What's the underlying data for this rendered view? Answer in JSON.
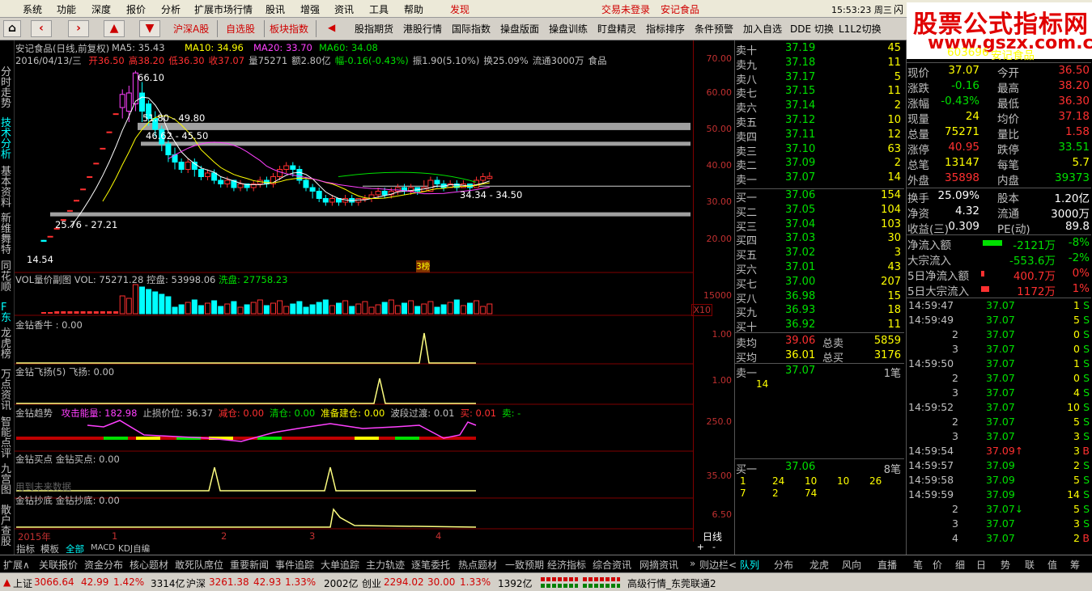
{
  "menu": [
    "系统",
    "功能",
    "深度",
    "报价",
    "分析",
    "扩展市场行情",
    "股讯",
    "增强",
    "资讯",
    "工具",
    "帮助",
    "发现"
  ],
  "login_status": "交易未登录",
  "login_stock": "安记食品",
  "clock": "15:53:23 周三",
  "clock_btn": "闪",
  "toolbar": [
    "沪深A股",
    "自选股",
    "板块指数",
    "股指期货",
    "港股行情",
    "国际指数",
    "操盘版面",
    "操盘训练",
    "盯盘精灵",
    "指标排序",
    "条件预警",
    "加入自选",
    "DDE 切换",
    "L1L2切换"
  ],
  "brand": {
    "title": "股票公式指标网",
    "url": "www.gszx.com.cn"
  },
  "left_nav": [
    "分时走势",
    "技术分析",
    "基本资料",
    "新维舞特",
    "同花顺",
    "F东",
    "龙虎榜",
    "万点资讯",
    "智能点评",
    "九宫图",
    "散户查股"
  ],
  "chart": {
    "title": "安记食品(日线,前复权)",
    "ma": [
      {
        "label": "MA5: 35.43",
        "color": "#ffffff"
      },
      {
        "label": "MA10: 34.96",
        "color": "#ffff00"
      },
      {
        "label": "MA20: 33.70",
        "color": "#ff40ff"
      },
      {
        "label": "MA60: 34.08",
        "color": "#00e000"
      }
    ],
    "info_date": "2016/04/13/三",
    "info_items": [
      {
        "t": "开36.50",
        "c": "#ff3030"
      },
      {
        "t": "高38.20",
        "c": "#ff3030"
      },
      {
        "t": "低36.30",
        "c": "#ff3030"
      },
      {
        "t": "收37.07",
        "c": "#ff3030"
      },
      {
        "t": "量75271",
        "c": "#c0c0c0"
      },
      {
        "t": "额2.80亿",
        "c": "#c0c0c0"
      },
      {
        "t": "幅-0.16(-0.43%)",
        "c": "#00e000"
      },
      {
        "t": "振1.90(5.10%)",
        "c": "#c0c0c0"
      },
      {
        "t": "换25.09%",
        "c": "#c0c0c0"
      },
      {
        "t": "流通3000万",
        "c": "#c0c0c0"
      },
      {
        "t": "食品",
        "c": "#c0c0c0"
      }
    ],
    "annotations": {
      "high": "66.10",
      "r1": "51.80 - 49.80",
      "r2": "46.62 - 45.50",
      "r3": "34.34 - 34.50",
      "r4": "25.76 - 27.21",
      "low": "14.54",
      "tag": "3榜"
    },
    "price_scale": [
      "70.00",
      "60.00",
      "50.00",
      "40.00",
      "30.00",
      "20.00"
    ],
    "vol_title": "VOL量价副图",
    "vol": "VOL: 75271.28",
    "kong": "控盘: 53998.06",
    "xi": "洗盘: 27758.23",
    "vol_scale": "15000",
    "vol_x": "X10",
    "ind1_title": "金钻香牛 : 0.00",
    "ind1_scale": "1.00",
    "ind2_title": "金钻飞扬(5)",
    "ind2_val": "飞扬: 0.00",
    "ind2_scale": "1.00",
    "ind3_title": "金钻趋势",
    "ind3_items": [
      {
        "t": "攻击能量: 182.98",
        "c": "#ff40ff"
      },
      {
        "t": "止损价位: 36.37",
        "c": "#c0c0c0"
      },
      {
        "t": "减仓: 0.00",
        "c": "#ff3030"
      },
      {
        "t": "清仓: 0.00",
        "c": "#00e000"
      },
      {
        "t": "准备建仓: 0.00",
        "c": "#ffff00"
      },
      {
        "t": "波段过渡: 0.01",
        "c": "#c0c0c0"
      },
      {
        "t": "买: 0.01",
        "c": "#ff3030"
      },
      {
        "t": "卖: -",
        "c": "#00e000"
      }
    ],
    "ind3_scale": "250.0",
    "ind4_title": "金钻买点",
    "ind4_val": "金钻买点: 0.00",
    "ind4_scale": "35.00",
    "future": "用到未来数据",
    "ind5_title": "金钻抄底",
    "ind5_val": "金钻抄底: 0.00",
    "ind5_scale": "6.50",
    "x_labels": [
      "2015年",
      "1",
      "2",
      "3",
      "4"
    ],
    "period": "日线",
    "tabs": [
      "指标",
      "模板",
      "全部",
      "MACD",
      "KDJ自编"
    ]
  },
  "orderbook": {
    "asks": [
      [
        "卖十",
        "37.19",
        "45"
      ],
      [
        "卖九",
        "37.18",
        "11"
      ],
      [
        "卖八",
        "37.17",
        "5"
      ],
      [
        "卖七",
        "37.15",
        "11"
      ],
      [
        "卖六",
        "37.14",
        "2"
      ],
      [
        "卖五",
        "37.12",
        "10"
      ],
      [
        "卖四",
        "37.11",
        "12"
      ],
      [
        "卖三",
        "37.10",
        "63"
      ],
      [
        "卖二",
        "37.09",
        "2"
      ],
      [
        "卖一",
        "37.07",
        "14"
      ]
    ],
    "bids": [
      [
        "买一",
        "37.06",
        "154"
      ],
      [
        "买二",
        "37.05",
        "104"
      ],
      [
        "买三",
        "37.04",
        "103"
      ],
      [
        "买四",
        "37.03",
        "30"
      ],
      [
        "买五",
        "37.02",
        "3"
      ],
      [
        "买六",
        "37.01",
        "43"
      ],
      [
        "买七",
        "37.00",
        "207"
      ],
      [
        "买八",
        "36.98",
        "15"
      ],
      [
        "买九",
        "36.93",
        "18"
      ],
      [
        "买十",
        "36.92",
        "11"
      ]
    ],
    "sell_avg": [
      "卖均",
      "39.06",
      "总卖",
      "5859"
    ],
    "buy_avg": [
      "买均",
      "36.01",
      "总买",
      "3176"
    ],
    "queue_sell": {
      "label": "卖一",
      "price": "37.07",
      "count": "1笔",
      "vols": [
        "14"
      ]
    },
    "queue_buy": {
      "label": "买一",
      "price": "37.06",
      "count": "8笔",
      "vols": [
        "1",
        "24",
        "10",
        "10",
        "26",
        "7",
        "2",
        "74"
      ]
    }
  },
  "quote": {
    "code": "603696",
    "name": "安记食品",
    "rows": [
      [
        "现价",
        "37.07",
        "今开",
        "36.50"
      ],
      [
        "涨跌",
        "-0.16",
        "最高",
        "38.20"
      ],
      [
        "涨幅",
        "-0.43%",
        "最低",
        "36.30"
      ],
      [
        "现量",
        "24",
        "均价",
        "37.18"
      ],
      [
        "总量",
        "75271",
        "量比",
        "1.58"
      ],
      [
        "涨停",
        "40.95",
        "跌停",
        "33.51"
      ],
      [
        "总笔",
        "13147",
        "每笔",
        "5.7"
      ],
      [
        "外盘",
        "35898",
        "内盘",
        "39373"
      ]
    ],
    "rows2": [
      [
        "换手",
        "25.09%",
        "股本",
        "1.20亿"
      ],
      [
        "净资",
        "4.32",
        "流通",
        "3000万"
      ],
      [
        "收益(三)",
        "0.309",
        "PE(动)",
        "89.8"
      ]
    ],
    "flow": [
      [
        "净流入额",
        "-2121万",
        "-8%"
      ],
      [
        "大宗流入",
        "-553.6万",
        "-2%"
      ],
      [
        "5日净流入额",
        "400.7万",
        "0%"
      ],
      [
        "5日大宗流入",
        "1172万",
        "1%"
      ]
    ],
    "ticks": [
      [
        "14:59:47",
        "37.07",
        "1",
        "S"
      ],
      [
        "14:59:49",
        "37.07",
        "5",
        "S"
      ],
      [
        "2",
        "37.07",
        "0",
        "S"
      ],
      [
        "3",
        "37.07",
        "0",
        "S"
      ],
      [
        "14:59:50",
        "37.07",
        "1",
        "S"
      ],
      [
        "2",
        "37.07",
        "0",
        "S"
      ],
      [
        "3",
        "37.07",
        "4",
        "S"
      ],
      [
        "14:59:52",
        "37.07",
        "10",
        "S"
      ],
      [
        "2",
        "37.07",
        "5",
        "S"
      ],
      [
        "3",
        "37.07",
        "3",
        "S"
      ],
      [
        "14:59:54",
        "37.09↑",
        "3",
        "B"
      ],
      [
        "14:59:57",
        "37.09",
        "2",
        "S"
      ],
      [
        "14:59:58",
        "37.09",
        "5",
        "S"
      ],
      [
        "14:59:59",
        "37.09",
        "14",
        "S"
      ],
      [
        "2",
        "37.07↓",
        "5",
        "S"
      ],
      [
        "3",
        "37.07",
        "3",
        "S"
      ],
      [
        "4",
        "37.07",
        "2",
        "B"
      ]
    ]
  },
  "bottom_tabs": [
    "扩展∧",
    "关联报价",
    "资金分布",
    "核心题材",
    "敢死队席位",
    "重要新闻",
    "事件追踪",
    "大单追踪",
    "主力轨迹",
    "逐笔委托",
    "热点题材",
    "一致预期",
    "经济指标",
    "综合资讯",
    "网摘资讯",
    "»",
    "则边栏<",
    "队列",
    "分布",
    "龙虎",
    "风向",
    "直播",
    "笔",
    "价",
    "细",
    "日",
    "势",
    "联",
    "值",
    "筹"
  ],
  "status": {
    "sh_label": "上证",
    "sh_val": "3066.64",
    "sh_chg": "42.99",
    "sh_pct": "1.42%",
    "sh_amt": "3314亿",
    "sz_label": "沪深",
    "sz_val": "3261.38",
    "sz_chg": "42.93",
    "sz_pct": "1.33%",
    "sz_amt": "2002亿",
    "cy_label": "创业",
    "cy_val": "2294.02",
    "cy_chg": "30.00",
    "cy_pct": "1.33%",
    "cy_amt": "1392亿",
    "feed": "高级行情_东莞联通2"
  },
  "candles": [
    {
      "o": 19.5,
      "c": 19.2,
      "h": 19.6,
      "l": 19.1
    },
    {
      "o": 20.5,
      "c": 20.6,
      "h": 20.7,
      "l": 20.4
    },
    {
      "o": 22.7,
      "c": 22.8,
      "h": 22.9,
      "l": 22.6
    },
    {
      "o": 25.1,
      "c": 25.2,
      "h": 25.3,
      "l": 25.0
    },
    {
      "o": 27.6,
      "c": 27.7,
      "h": 27.8,
      "l": 27.5
    },
    {
      "o": 30.4,
      "c": 30.5,
      "h": 30.6,
      "l": 30.3
    },
    {
      "o": 33.5,
      "c": 33.6,
      "h": 33.7,
      "l": 33.4
    },
    {
      "o": 36.9,
      "c": 37.0,
      "h": 37.1,
      "l": 36.8
    },
    {
      "o": 40.6,
      "c": 40.7,
      "h": 40.8,
      "l": 40.5
    },
    {
      "o": 44.7,
      "c": 44.8,
      "h": 44.9,
      "l": 44.6
    },
    {
      "o": 49.2,
      "c": 49.3,
      "h": 49.4,
      "l": 49.1
    },
    {
      "o": 54.2,
      "c": 54.3,
      "h": 54.4,
      "l": 54.1
    },
    {
      "o": 56,
      "c": 59.6,
      "h": 61,
      "l": 53
    },
    {
      "o": 55,
      "c": 60,
      "h": 62,
      "l": 52
    },
    {
      "o": 57,
      "c": 65.5,
      "h": 66.1,
      "l": 55
    },
    {
      "o": 60,
      "c": 55,
      "h": 63,
      "l": 52
    },
    {
      "o": 57,
      "c": 53,
      "h": 58,
      "l": 51
    },
    {
      "o": 53,
      "c": 50,
      "h": 55,
      "l": 48
    },
    {
      "o": 50,
      "c": 46,
      "h": 51,
      "l": 44
    },
    {
      "o": 46,
      "c": 43,
      "h": 47,
      "l": 41
    },
    {
      "o": 43,
      "c": 41,
      "h": 45,
      "l": 39
    },
    {
      "o": 41,
      "c": 39,
      "h": 42,
      "l": 38
    },
    {
      "o": 39,
      "c": 41,
      "h": 42,
      "l": 38
    },
    {
      "o": 41,
      "c": 39,
      "h": 42,
      "l": 37
    },
    {
      "o": 39,
      "c": 37,
      "h": 40,
      "l": 36
    },
    {
      "o": 37,
      "c": 38,
      "h": 39,
      "l": 36
    },
    {
      "o": 38,
      "c": 36,
      "h": 39,
      "l": 35
    },
    {
      "o": 36,
      "c": 35,
      "h": 37,
      "l": 34
    },
    {
      "o": 35,
      "c": 36,
      "h": 37,
      "l": 34
    },
    {
      "o": 36,
      "c": 34,
      "h": 36,
      "l": 33
    },
    {
      "o": 34,
      "c": 35,
      "h": 36,
      "l": 33
    },
    {
      "o": 35,
      "c": 34,
      "h": 35,
      "l": 33
    },
    {
      "o": 34,
      "c": 35,
      "h": 36,
      "l": 33
    },
    {
      "o": 35,
      "c": 36,
      "h": 37,
      "l": 34
    },
    {
      "o": 36,
      "c": 35,
      "h": 37,
      "l": 34
    },
    {
      "o": 35,
      "c": 37,
      "h": 38,
      "l": 34
    },
    {
      "o": 37,
      "c": 39,
      "h": 40,
      "l": 36
    },
    {
      "o": 39,
      "c": 40,
      "h": 41,
      "l": 38
    },
    {
      "o": 40,
      "c": 39,
      "h": 41,
      "l": 37
    },
    {
      "o": 39,
      "c": 36,
      "h": 40,
      "l": 35
    },
    {
      "o": 36,
      "c": 34,
      "h": 37,
      "l": 33
    },
    {
      "o": 34,
      "c": 33,
      "h": 35,
      "l": 31
    },
    {
      "o": 33,
      "c": 31,
      "h": 34,
      "l": 30
    },
    {
      "o": 31,
      "c": 30,
      "h": 32,
      "l": 29
    },
    {
      "o": 30,
      "c": 31,
      "h": 32,
      "l": 29
    },
    {
      "o": 31,
      "c": 30,
      "h": 31,
      "l": 29
    },
    {
      "o": 30,
      "c": 31,
      "h": 32,
      "l": 29
    },
    {
      "o": 31,
      "c": 30,
      "h": 32,
      "l": 29
    },
    {
      "o": 30,
      "c": 31,
      "h": 31,
      "l": 29
    },
    {
      "o": 31,
      "c": 31,
      "h": 32,
      "l": 30
    },
    {
      "o": 31,
      "c": 32,
      "h": 33,
      "l": 30
    },
    {
      "o": 32,
      "c": 33,
      "h": 34,
      "l": 31
    },
    {
      "o": 33,
      "c": 32,
      "h": 34,
      "l": 31
    },
    {
      "o": 32,
      "c": 33,
      "h": 34,
      "l": 31
    },
    {
      "o": 33,
      "c": 34,
      "h": 35,
      "l": 32
    },
    {
      "o": 34,
      "c": 33,
      "h": 35,
      "l": 32
    },
    {
      "o": 33,
      "c": 34,
      "h": 35,
      "l": 32
    },
    {
      "o": 34,
      "c": 33,
      "h": 34,
      "l": 32
    },
    {
      "o": 33,
      "c": 34,
      "h": 36,
      "l": 33
    },
    {
      "o": 33,
      "c": 36,
      "h": 37,
      "l": 33
    },
    {
      "o": 36,
      "c": 35,
      "h": 37,
      "l": 34
    },
    {
      "o": 35,
      "c": 34,
      "h": 36,
      "l": 33
    },
    {
      "o": 34,
      "c": 35,
      "h": 36,
      "l": 34
    },
    {
      "o": 35,
      "c": 34,
      "h": 36,
      "l": 33
    },
    {
      "o": 34,
      "c": 35,
      "h": 36,
      "l": 34
    },
    {
      "o": 35,
      "c": 34,
      "h": 35,
      "l": 33
    },
    {
      "o": 34,
      "c": 36,
      "h": 37,
      "l": 34
    },
    {
      "o": 36,
      "c": 37,
      "h": 38,
      "l": 35
    },
    {
      "o": 36.5,
      "c": 37.07,
      "h": 38.2,
      "l": 36.3
    }
  ]
}
